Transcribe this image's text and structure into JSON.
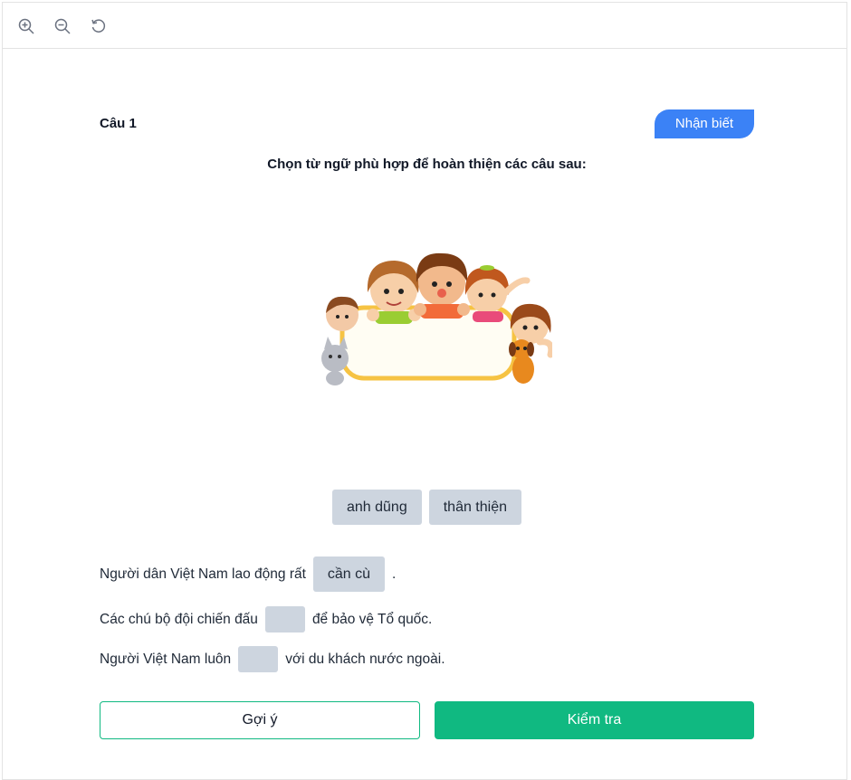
{
  "toolbar": {
    "zoom_in_icon": "zoom-in-icon",
    "zoom_out_icon": "zoom-out-icon",
    "reset_icon": "rotate-icon"
  },
  "question": {
    "title": "Câu 1",
    "level": "Nhận biết",
    "instruction": "Chọn từ ngữ phù hợp để hoàn thiện các câu sau:",
    "level_color": "#3b82f6"
  },
  "word_bank": [
    "anh dũng",
    "thân thiện"
  ],
  "sentences": [
    {
      "before": "Người dân Việt Nam lao động rất",
      "answer": "cần cù",
      "after": "."
    },
    {
      "before": "Các chú bộ đội chiến đấu",
      "answer": "",
      "after": "để bảo vệ Tổ quốc."
    },
    {
      "before": "Người Việt Nam luôn",
      "answer": "",
      "after": "với du khách nước ngoài."
    }
  ],
  "buttons": {
    "hint": "Gợi ý",
    "check": "Kiểm tra",
    "check_color": "#10b981"
  }
}
